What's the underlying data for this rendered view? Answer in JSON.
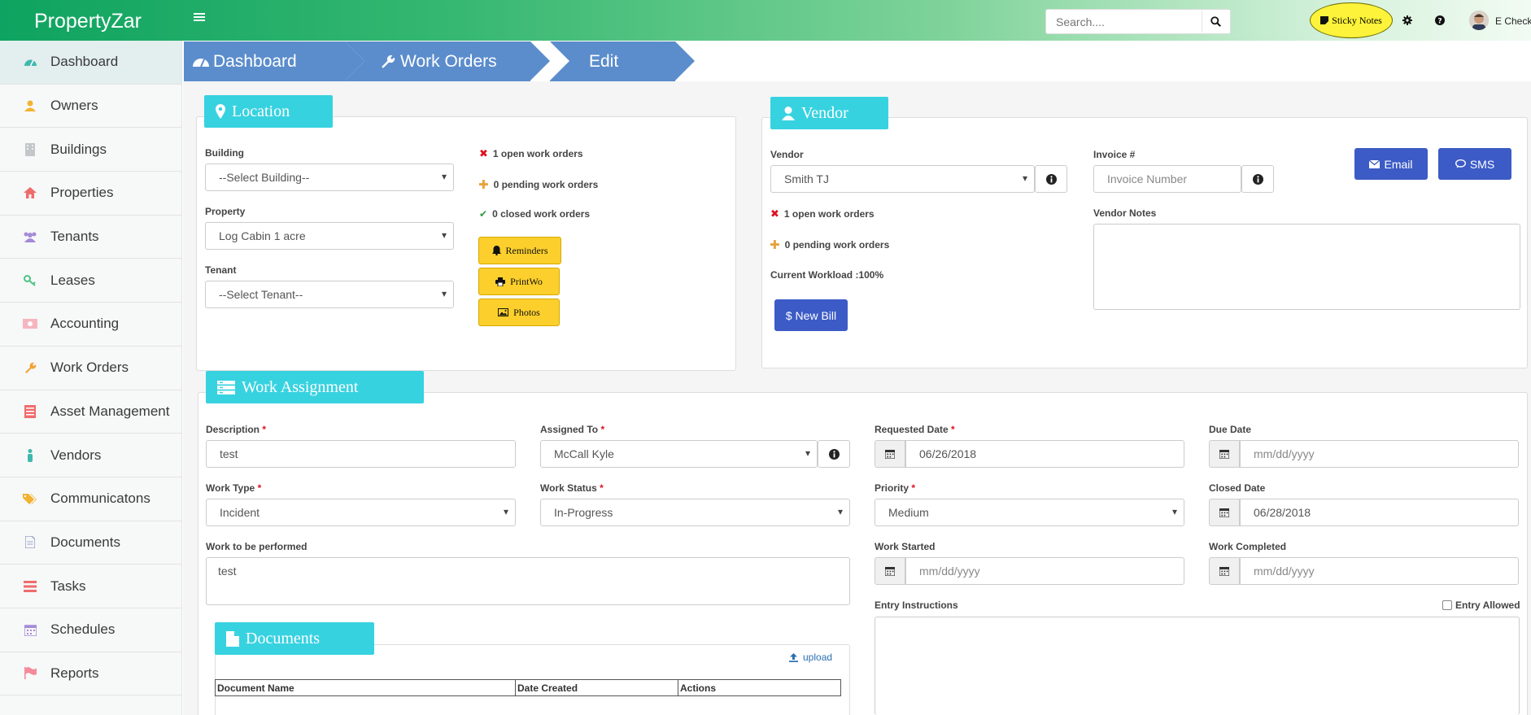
{
  "app": {
    "brand": "PropertyZar"
  },
  "topbar": {
    "search_placeholder": "Search....",
    "sticky_notes": "Sticky Notes",
    "user_name": "E Check"
  },
  "sidebar": {
    "items": [
      {
        "label": "Dashboard",
        "icon": "dashboard-icon"
      },
      {
        "label": "Owners",
        "icon": "user-icon"
      },
      {
        "label": "Buildings",
        "icon": "building-icon"
      },
      {
        "label": "Properties",
        "icon": "home-icon"
      },
      {
        "label": "Tenants",
        "icon": "users-icon"
      },
      {
        "label": "Leases",
        "icon": "key-icon"
      },
      {
        "label": "Accounting",
        "icon": "money-icon"
      },
      {
        "label": "Work Orders",
        "icon": "wrench-icon"
      },
      {
        "label": "Asset Management",
        "icon": "list-icon"
      },
      {
        "label": "Vendors",
        "icon": "person-icon"
      },
      {
        "label": "Communicatons",
        "icon": "tags-icon"
      },
      {
        "label": "Documents",
        "icon": "file-icon"
      },
      {
        "label": "Tasks",
        "icon": "tasks-icon"
      },
      {
        "label": "Schedules",
        "icon": "calendar-icon"
      },
      {
        "label": "Reports",
        "icon": "flag-icon"
      }
    ]
  },
  "breadcrumb": {
    "dashboard": "Dashboard",
    "work_orders": "Work Orders",
    "edit": "Edit"
  },
  "location": {
    "title": "Location",
    "building_label": "Building",
    "building_value": "--Select Building--",
    "property_label": "Property",
    "property_value": "Log Cabin 1 acre",
    "tenant_label": "Tenant",
    "tenant_value": "--Select Tenant--",
    "open_orders": "1 open work orders",
    "pending_orders": "0 pending work orders",
    "closed_orders": "0 closed work orders",
    "reminders": "Reminders",
    "print": "PrintWo",
    "photos": "Photos"
  },
  "vendor": {
    "title": "Vendor",
    "vendor_label": "Vendor",
    "vendor_value": "Smith TJ",
    "invoice_label": "Invoice #",
    "invoice_placeholder": "Invoice Number",
    "email": "Email",
    "sms": "SMS",
    "open_orders": "1 open work orders",
    "pending_orders": "0 pending work orders",
    "workload": "Current Workload :100%",
    "notes_label": "Vendor Notes",
    "new_bill": "$ New Bill"
  },
  "assignment": {
    "title": "Work Assignment",
    "description_label": "Description",
    "description_value": "test",
    "assigned_label": "Assigned To",
    "assigned_value": "McCall Kyle",
    "requested_label": "Requested Date",
    "requested_value": "06/26/2018",
    "due_label": "Due Date",
    "due_placeholder": "mm/dd/yyyy",
    "work_type_label": "Work Type",
    "work_type_value": "Incident",
    "work_status_label": "Work Status",
    "work_status_value": "In-Progress",
    "priority_label": "Priority",
    "priority_value": "Medium",
    "closed_label": "Closed Date",
    "closed_value": "06/28/2018",
    "work_performed_label": "Work to be performed",
    "work_performed_value": "test",
    "work_started_label": "Work Started",
    "work_started_placeholder": "mm/dd/yyyy",
    "work_completed_label": "Work Completed",
    "work_completed_placeholder": "mm/dd/yyyy",
    "entry_label": "Entry Instructions",
    "entry_allowed": "Entry Allowed"
  },
  "documents": {
    "title": "Documents",
    "upload": "upload",
    "columns": [
      "Document Name",
      "Date Created",
      "Actions"
    ]
  },
  "colors": {
    "accent": "#37d2e0",
    "primary": "#3c5bc6",
    "breadcrumb": "#5b8dcc",
    "warning": "#fccf2c"
  }
}
